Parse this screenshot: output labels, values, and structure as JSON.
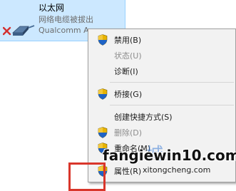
{
  "adapter": {
    "name": "以太网",
    "status": "网络电缆被拔出",
    "device": "Qualcomm A",
    "icon": "ethernet-adapter-disconnected-icon"
  },
  "menu": {
    "items": [
      {
        "label": "禁用(B)",
        "shield": true,
        "enabled": true
      },
      {
        "label": "状态(U)",
        "shield": false,
        "enabled": false
      },
      {
        "label": "诊断(I)",
        "shield": false,
        "enabled": true
      },
      {
        "label": "桥接(G)",
        "shield": true,
        "enabled": true
      },
      {
        "label": "创建快捷方式(S)",
        "shield": false,
        "enabled": true
      },
      {
        "label": "删除(D)",
        "shield": true,
        "enabled": false
      },
      {
        "label": "重命名(M)",
        "shield": true,
        "enabled": true
      },
      {
        "label": "属性(R)",
        "shield": true,
        "enabled": true
      }
    ]
  },
  "watermark": {
    "main": "fangiewin10.com",
    "sub": "xitongcheng.com",
    "logo": "城"
  }
}
